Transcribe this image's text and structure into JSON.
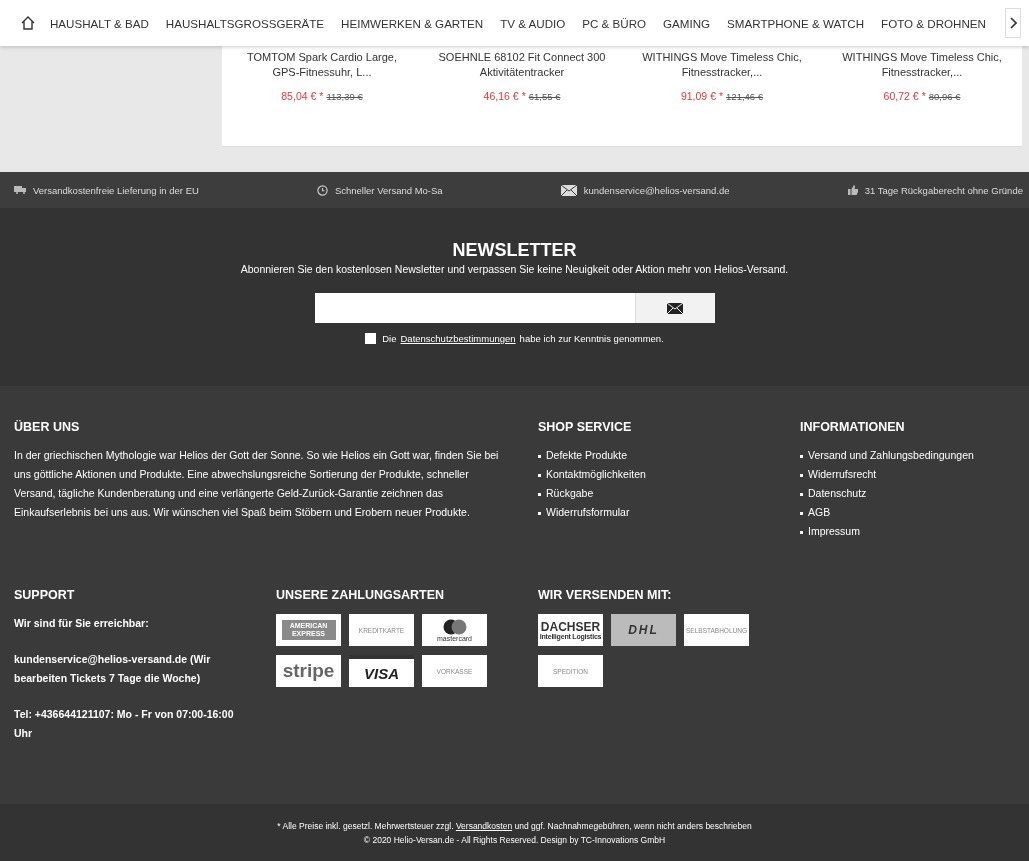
{
  "nav": {
    "items": [
      {
        "label": "HAUSHALT & BAD"
      },
      {
        "label": "HAUSHALTSGROSSGERÄTE"
      },
      {
        "label": "HEIMWERKEN & GARTEN"
      },
      {
        "label": "TV & AUDIO"
      },
      {
        "label": "PC & BÜRO"
      },
      {
        "label": "GAMING"
      },
      {
        "label": "SMARTPHONE & WATCH"
      },
      {
        "label": "FOTO & DROHNEN"
      }
    ]
  },
  "products": [
    {
      "name": "TOMTOM Spark Cardio Large, GPS-Fitnessuhr, L...",
      "price": "85,04 €",
      "star": "*",
      "old_price": "113,39 €"
    },
    {
      "name": "SOEHNLE 68102 Fit Connect 300 Aktivitätentracker",
      "price": "46,16 €",
      "star": "*",
      "old_price": "61,55 €"
    },
    {
      "name": "WITHINGS Move Timeless Chic, Fitnesstracker,...",
      "price": "91,09 €",
      "star": "*",
      "old_price": "121,46 €"
    },
    {
      "name": "WITHINGS Move Timeless Chic, Fitnesstracker,...",
      "price": "60,72 €",
      "star": "*",
      "old_price": "80,96 €"
    }
  ],
  "service_bar": [
    {
      "kind": "truck",
      "text": "Versandkostenfreie Lieferung in der EU"
    },
    {
      "kind": "clock",
      "text": "Schneller Versand Mo-Sa"
    },
    {
      "kind": "mail",
      "text": "kundenservice@helios-versand.de"
    },
    {
      "kind": "thumb",
      "text": "31 Tage Rückgaberecht ohne Gründe"
    }
  ],
  "newsletter": {
    "title": "NEWSLETTER",
    "subtitle": "Abonnieren Sie den kostenlosen Newsletter und verpassen Sie keine Neuigkeit oder Aktion mehr von Helios-Versand.",
    "consent_before": "Die",
    "consent_link": "Datenschutzbestimmungen",
    "consent_after": "habe ich zur Kenntnis genommen.",
    "checked": false
  },
  "about": {
    "title": "ÜBER UNS",
    "text": "In der griechischen Mythologie war Helios der Gott der Sonne. So wie Helios ein Gott war, finden Sie bei uns göttliche Aktionen und Produkte. Eine abwechslungsreiche Sortierung der Produkte, schneller Versand, tägliche Kundenberatung und eine verlängerte Geld-Zurück-Garantie zeichnen das Einkaufserlebnis bei uns aus. Wir wünschen viel Spaß beim Stöbern und Erobern neuer Produkte."
  },
  "shop_service": {
    "title": "SHOP SERVICE",
    "links": [
      "Defekte Produkte",
      "Kontaktmöglichkeiten",
      "Rückgabe",
      "Widerrufsformular"
    ]
  },
  "informationen": {
    "title": "INFORMATIONEN",
    "links": [
      "Versand und Zahlungsbedingungen",
      "Widerrufsrecht",
      "Datenschutz",
      "AGB",
      "Impressum"
    ]
  },
  "support": {
    "title": "SUPPORT",
    "lines": [
      "Wir sind für Sie erreichbar:",
      "kundenservice@helios-versand.de (Wir bearbeiten Tickets 7 Tage die Woche)",
      "Tel: +436644121107: Mo - Fr von 07:00-16:00 Uhr"
    ]
  },
  "payment": {
    "title": "UNSERE ZAHLUNGSARTEN",
    "methods": [
      {
        "kind": "amex",
        "label": "AMERICAN EXPRESS"
      },
      {
        "kind": "plain",
        "label": "KREDITKARTE"
      },
      {
        "kind": "mastercard",
        "label": "mastercard"
      },
      {
        "kind": "stripe",
        "label": "stripe"
      },
      {
        "kind": "visa",
        "label": "VISA"
      },
      {
        "kind": "plain",
        "label": "VORKASSE"
      }
    ]
  },
  "shipping": {
    "title": "WIR VERSENDEN MIT:",
    "carriers": [
      {
        "kind": "dachser",
        "label": "DACHSER",
        "sub": "Intelligent Logistics"
      },
      {
        "kind": "dhl",
        "label": "DHL"
      },
      {
        "kind": "plain",
        "label": "SELBSTABHOLUNG"
      },
      {
        "kind": "plain",
        "label": "SPEDITION"
      }
    ]
  },
  "legal": {
    "before": "* Alle Preise inkl. gesetzl. Mehrwertsteuer zzgl.",
    "link": "Versandkosten",
    "after": "und ggf. Nachnahmegebühren, wenn nicht anders beschrieben",
    "copyright": "© 2020 Helio-Versan.de - All Rights Reserved. Design by TC-Innovations GmbH"
  }
}
